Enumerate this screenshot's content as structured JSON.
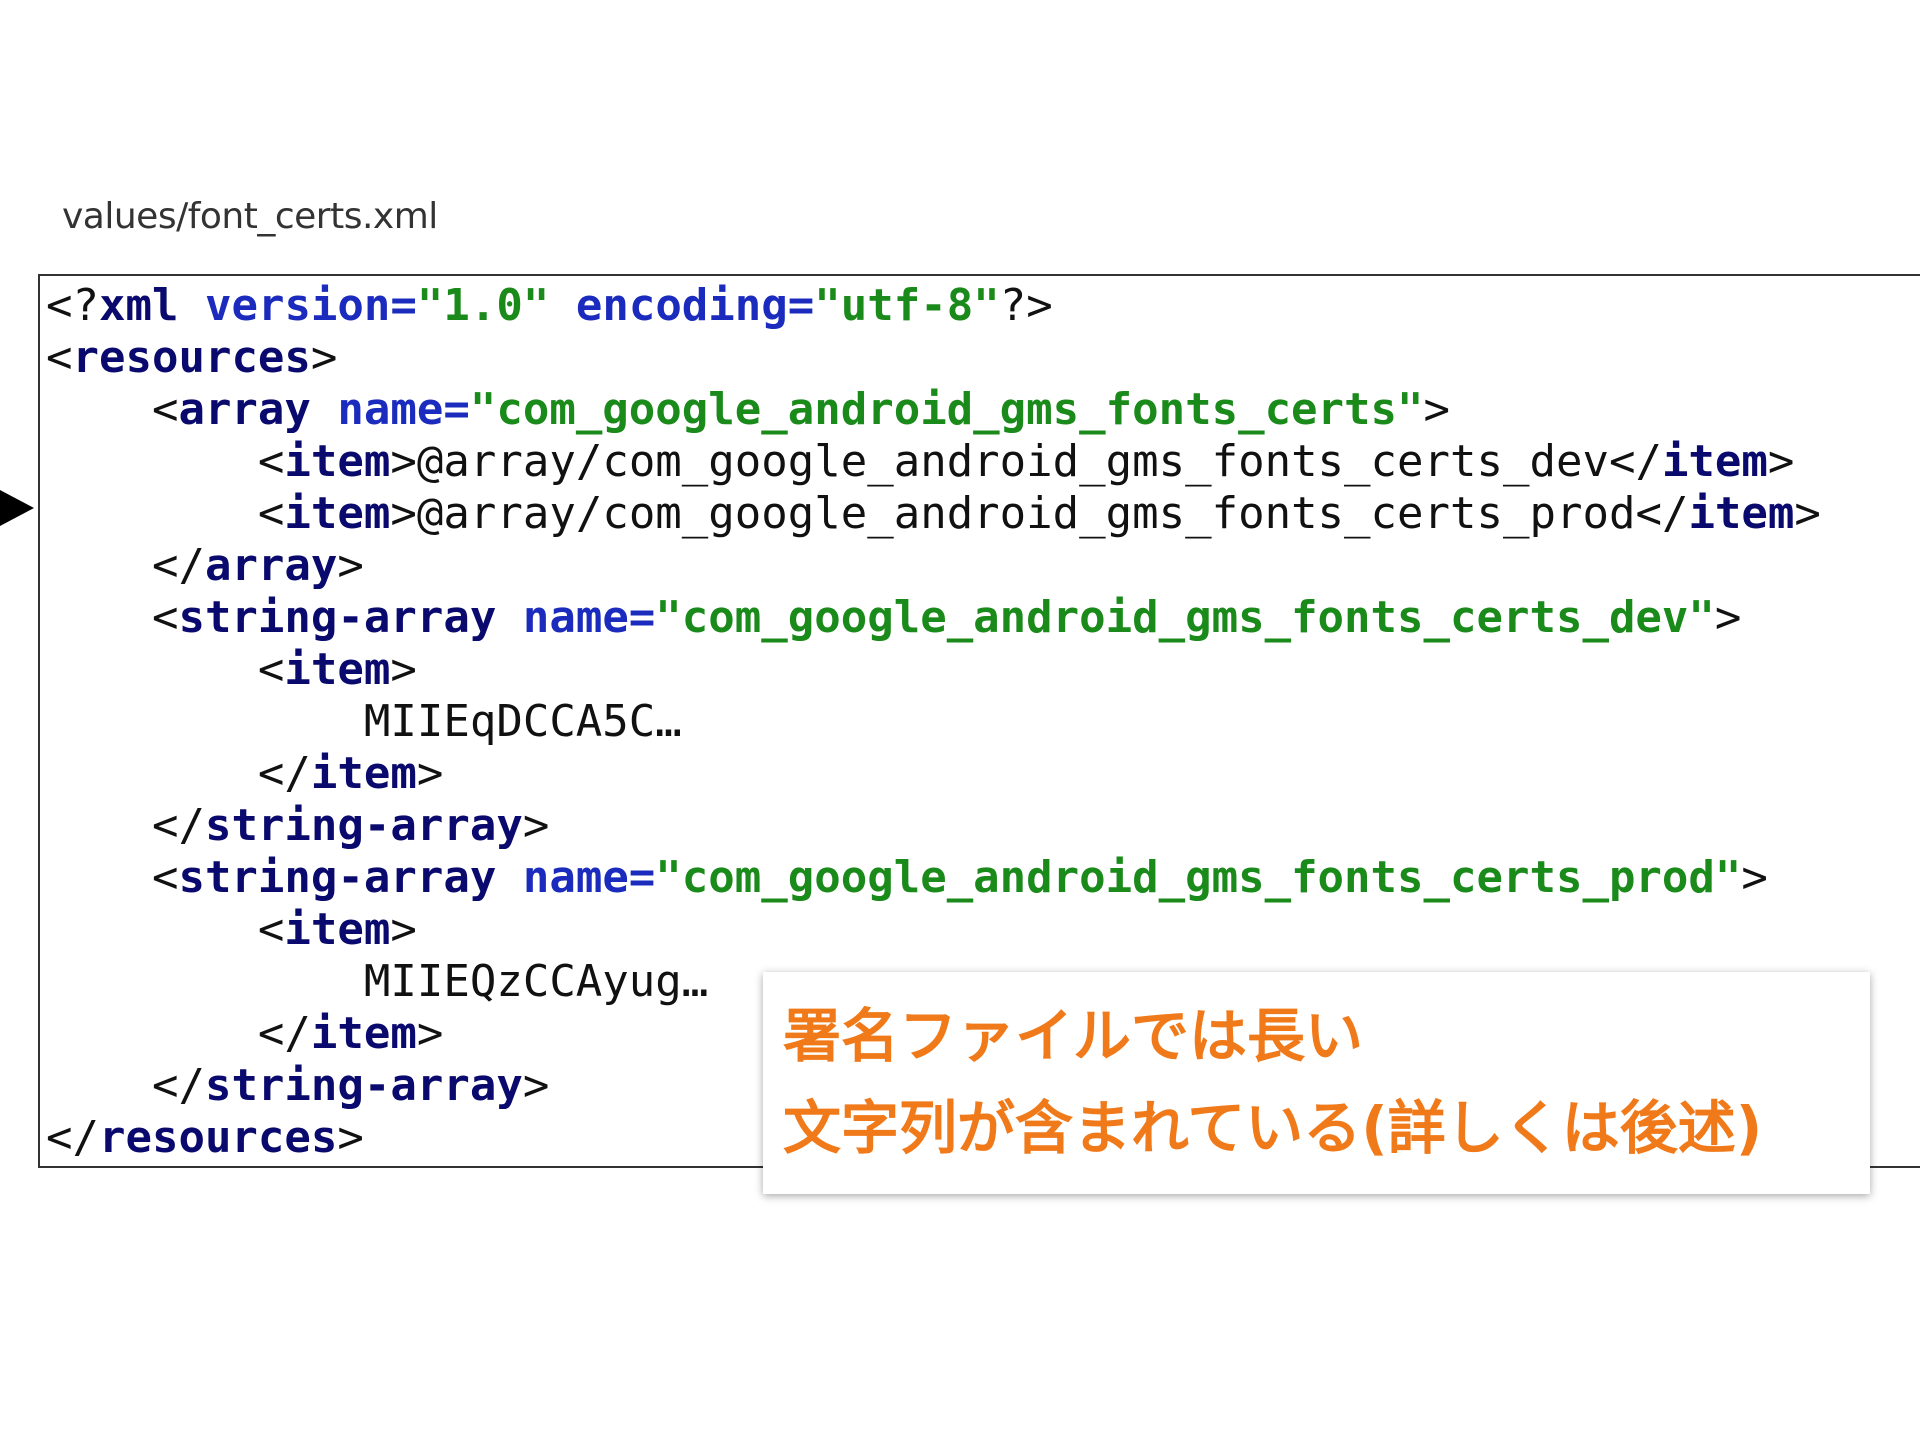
{
  "file_caption": "values/font_certs.xml",
  "code_lines": [
    [
      {
        "c": "punct",
        "t": "<?"
      },
      {
        "c": "tag",
        "t": "xml"
      },
      {
        "c": "punct",
        "t": " "
      },
      {
        "c": "attr",
        "t": "version="
      },
      {
        "c": "val",
        "t": "\"1.0\""
      },
      {
        "c": "punct",
        "t": " "
      },
      {
        "c": "attr",
        "t": "encoding="
      },
      {
        "c": "val",
        "t": "\"utf-8\""
      },
      {
        "c": "punct",
        "t": "?>"
      }
    ],
    [
      {
        "c": "punct",
        "t": "<"
      },
      {
        "c": "tag",
        "t": "resources"
      },
      {
        "c": "punct",
        "t": ">"
      }
    ],
    [
      {
        "c": "punct",
        "t": "    <"
      },
      {
        "c": "tag",
        "t": "array"
      },
      {
        "c": "punct",
        "t": " "
      },
      {
        "c": "attr",
        "t": "name="
      },
      {
        "c": "val",
        "t": "\"com_google_android_gms_fonts_certs\""
      },
      {
        "c": "punct",
        "t": ">"
      }
    ],
    [
      {
        "c": "punct",
        "t": "        <"
      },
      {
        "c": "tag",
        "t": "item"
      },
      {
        "c": "punct",
        "t": ">"
      },
      {
        "c": "txt",
        "t": "@array/com_google_android_gms_fonts_certs_dev"
      },
      {
        "c": "punct",
        "t": "</"
      },
      {
        "c": "tag",
        "t": "item"
      },
      {
        "c": "punct",
        "t": ">"
      }
    ],
    [
      {
        "c": "punct",
        "t": "        <"
      },
      {
        "c": "tag",
        "t": "item"
      },
      {
        "c": "punct",
        "t": ">"
      },
      {
        "c": "txt",
        "t": "@array/com_google_android_gms_fonts_certs_prod"
      },
      {
        "c": "punct",
        "t": "</"
      },
      {
        "c": "tag",
        "t": "item"
      },
      {
        "c": "punct",
        "t": ">"
      }
    ],
    [
      {
        "c": "punct",
        "t": "    </"
      },
      {
        "c": "tag",
        "t": "array"
      },
      {
        "c": "punct",
        "t": ">"
      }
    ],
    [
      {
        "c": "punct",
        "t": "    <"
      },
      {
        "c": "tag",
        "t": "string-array"
      },
      {
        "c": "punct",
        "t": " "
      },
      {
        "c": "attr",
        "t": "name="
      },
      {
        "c": "val",
        "t": "\"com_google_android_gms_fonts_certs_dev\""
      },
      {
        "c": "punct",
        "t": ">"
      }
    ],
    [
      {
        "c": "punct",
        "t": "        <"
      },
      {
        "c": "tag",
        "t": "item"
      },
      {
        "c": "punct",
        "t": ">"
      }
    ],
    [
      {
        "c": "txt",
        "t": "            MIIEqDCCA5C…"
      }
    ],
    [
      {
        "c": "punct",
        "t": "        </"
      },
      {
        "c": "tag",
        "t": "item"
      },
      {
        "c": "punct",
        "t": ">"
      }
    ],
    [
      {
        "c": "punct",
        "t": "    </"
      },
      {
        "c": "tag",
        "t": "string-array"
      },
      {
        "c": "punct",
        "t": ">"
      }
    ],
    [
      {
        "c": "punct",
        "t": "    <"
      },
      {
        "c": "tag",
        "t": "string-array"
      },
      {
        "c": "punct",
        "t": " "
      },
      {
        "c": "attr",
        "t": "name="
      },
      {
        "c": "val",
        "t": "\"com_google_android_gms_fonts_certs_prod\""
      },
      {
        "c": "punct",
        "t": ">"
      }
    ],
    [
      {
        "c": "punct",
        "t": "        <"
      },
      {
        "c": "tag",
        "t": "item"
      },
      {
        "c": "punct",
        "t": ">"
      }
    ],
    [
      {
        "c": "txt",
        "t": "            MIIEQzCCAyug…"
      }
    ],
    [
      {
        "c": "punct",
        "t": "        </"
      },
      {
        "c": "tag",
        "t": "item"
      },
      {
        "c": "punct",
        "t": ">"
      }
    ],
    [
      {
        "c": "punct",
        "t": "    </"
      },
      {
        "c": "tag",
        "t": "string-array"
      },
      {
        "c": "punct",
        "t": ">"
      }
    ],
    [
      {
        "c": "punct",
        "t": "</"
      },
      {
        "c": "tag",
        "t": "resources"
      },
      {
        "c": "punct",
        "t": ">"
      }
    ]
  ],
  "callout": {
    "line1": "署名ファイルでは長い",
    "line2": "文字列が含まれている(詳しくは後述)"
  },
  "colors": {
    "tag": "#0a0a6e",
    "attribute": "#1a2bbd",
    "value": "#1a8a1a",
    "callout_text": "#f07a1a"
  },
  "icons": {
    "marker": "right-pointing-triangle"
  }
}
